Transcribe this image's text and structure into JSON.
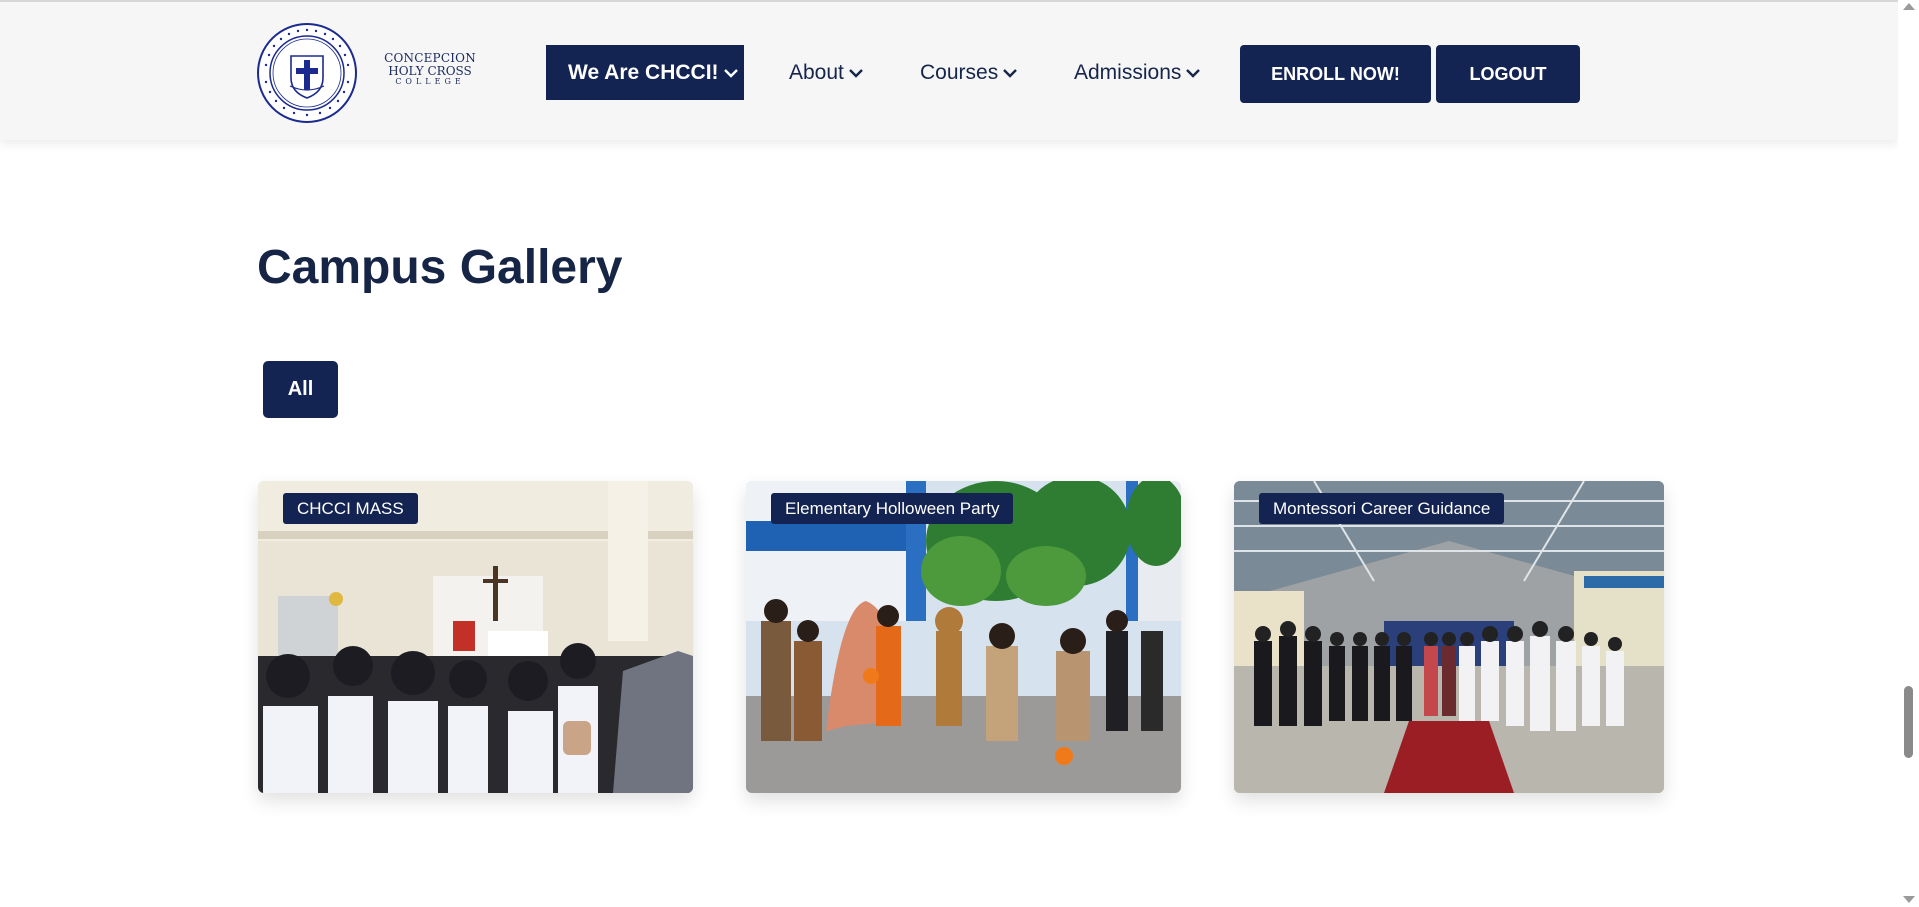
{
  "brand": {
    "name_line1": "CONCEPCION",
    "name_line2": "HOLY CROSS",
    "name_line3": "COLLEGE",
    "seal_text": "CONCEPCION HOLY CROSS COLLEGE INC.",
    "color": "#1a2a5e"
  },
  "nav": {
    "items": [
      {
        "label": "We Are CHCCI!",
        "active": true
      },
      {
        "label": "About",
        "active": false
      },
      {
        "label": "Courses",
        "active": false
      },
      {
        "label": "Admissions",
        "active": false
      }
    ],
    "enroll_label": "ENROLL NOW!",
    "logout_label": "LOGOUT"
  },
  "gallery": {
    "title": "Campus Gallery",
    "filters": [
      {
        "label": "All",
        "active": true
      }
    ],
    "cards": [
      {
        "label": "CHCCI MASS",
        "image": "students-at-outdoor-mass-photo"
      },
      {
        "label": "Elementary Holloween Party",
        "image": "children-in-halloween-costumes-photo"
      },
      {
        "label": "Montessori Career Guidance",
        "image": "students-in-covered-court-photo"
      }
    ]
  },
  "colors": {
    "primary": "#142452",
    "header_bg": "#f6f6f6",
    "title": "#162545"
  }
}
